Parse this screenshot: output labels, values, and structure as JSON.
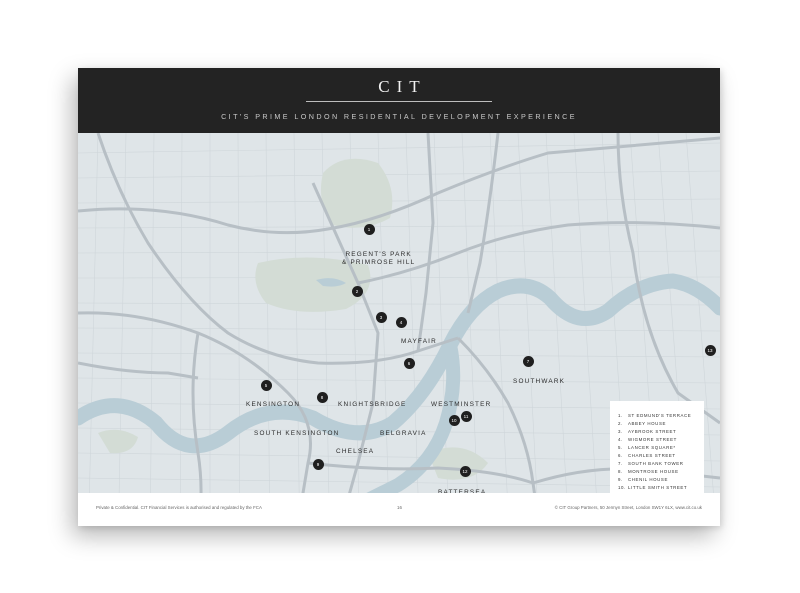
{
  "header": {
    "brand": "CIT",
    "subtitle": "CIT'S PRIME LONDON RESIDENTIAL DEVELOPMENT EXPERIENCE"
  },
  "map": {
    "areas": [
      {
        "id": "regents-park",
        "line1": "REGENT'S PARK",
        "line2": "& PRIMROSE HILL"
      },
      {
        "id": "mayfair",
        "line1": "MAYFAIR"
      },
      {
        "id": "southwark",
        "line1": "SOUTHWARK"
      },
      {
        "id": "kensington",
        "line1": "KENSINGTON"
      },
      {
        "id": "knightsbridge",
        "line1": "KNIGHTSBRIDGE"
      },
      {
        "id": "westminster",
        "line1": "WESTMINSTER"
      },
      {
        "id": "south-kensington",
        "line1": "SOUTH KENSINGTON"
      },
      {
        "id": "belgravia",
        "line1": "BELGRAVIA"
      },
      {
        "id": "chelsea",
        "line1": "CHELSEA"
      },
      {
        "id": "battersea",
        "line1": "BATTERSEA"
      }
    ],
    "markers": [
      "1",
      "2",
      "3",
      "4",
      "5",
      "6",
      "7",
      "8",
      "9",
      "10",
      "11",
      "12",
      "13"
    ],
    "colors": {
      "land": "#dfe5e8",
      "water": "#b9cdd6",
      "road": "#b7bfc5",
      "street": "#cfd6da",
      "park": "#d3dcd5"
    }
  },
  "legend": {
    "items": [
      {
        "num": "1.",
        "name": "ST EDMUND'S TERRACE"
      },
      {
        "num": "2.",
        "name": "ABBEY HOUSE"
      },
      {
        "num": "3.",
        "name": "AYBROOK STREET"
      },
      {
        "num": "4.",
        "name": "WIGMORE STREET"
      },
      {
        "num": "5.",
        "name": "LANCER SQUARE*"
      },
      {
        "num": "6.",
        "name": "CHARLES STREET"
      },
      {
        "num": "7.",
        "name": "SOUTH BANK TOWER"
      },
      {
        "num": "8.",
        "name": "MONTROSE HOUSE"
      },
      {
        "num": "9.",
        "name": "CHENIL HOUSE"
      },
      {
        "num": "10.",
        "name": "LITTLE SMITH STREET"
      },
      {
        "num": "11.",
        "name": "GREAT PETER STREET"
      },
      {
        "num": "12.",
        "name": "ONE NINE ELMS*"
      },
      {
        "num": "13.",
        "name": "QUAY HOUSE*"
      }
    ],
    "note": "* CIT acting as development managers"
  },
  "footer": {
    "left": "Private & Confidential. CIT Financial Services is authorised and regulated by the FCA",
    "page": "16",
    "right": "© CIT Group Partners, 50 Jermyn Street, London SW1Y 6LX, www.cit.co.uk"
  }
}
